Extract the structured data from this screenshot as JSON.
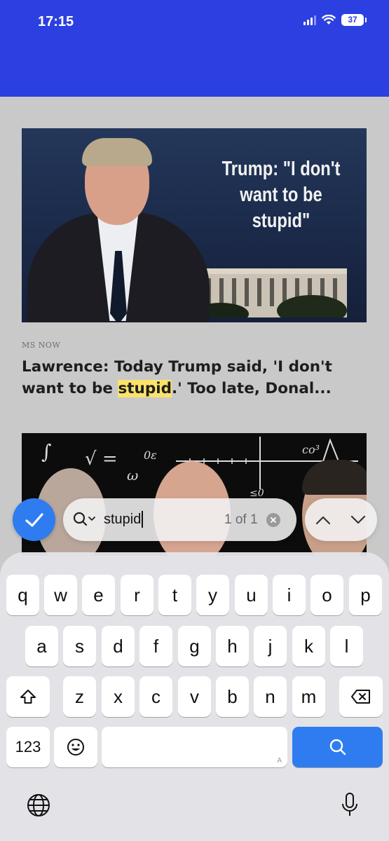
{
  "status_bar": {
    "time": "17:15",
    "battery": "37",
    "icons": [
      "cellular-signal-icon",
      "wifi-icon",
      "battery-icon"
    ]
  },
  "colors": {
    "header": "#2c3fe0",
    "page_background": "#c9c9c9",
    "highlight": "#fbe36a",
    "accent": "#2f7cf0"
  },
  "articles": [
    {
      "image_caption": "Trump: \"I don't want to be stupid\"",
      "source": "MS NOW",
      "headline_before": "Lawrence: Today Trump said, 'I don't want to be ",
      "headline_match": "stupid",
      "headline_after": ".' Too late, Donal..."
    },
    {
      "image_chalk": [
        "∫",
        "√ =",
        "ω",
        "0ε",
        "≤0",
        "co³"
      ]
    }
  ],
  "find_bar": {
    "query": "stupid",
    "match_count": "1 of 1",
    "icons": [
      "checkmark-icon",
      "search-options-icon",
      "clear-icon",
      "chevron-up-icon",
      "chevron-down-icon"
    ]
  },
  "keyboard": {
    "row1": [
      "q",
      "w",
      "e",
      "r",
      "t",
      "y",
      "u",
      "i",
      "o",
      "p"
    ],
    "row2": [
      "a",
      "s",
      "d",
      "f",
      "g",
      "h",
      "j",
      "k",
      "l"
    ],
    "row3": [
      "z",
      "x",
      "c",
      "v",
      "b",
      "n",
      "m"
    ],
    "numbers_key": "123",
    "space_hint": "A",
    "icons": [
      "shift-icon",
      "delete-icon",
      "emoji-icon",
      "search-icon",
      "globe-icon",
      "microphone-icon"
    ]
  }
}
